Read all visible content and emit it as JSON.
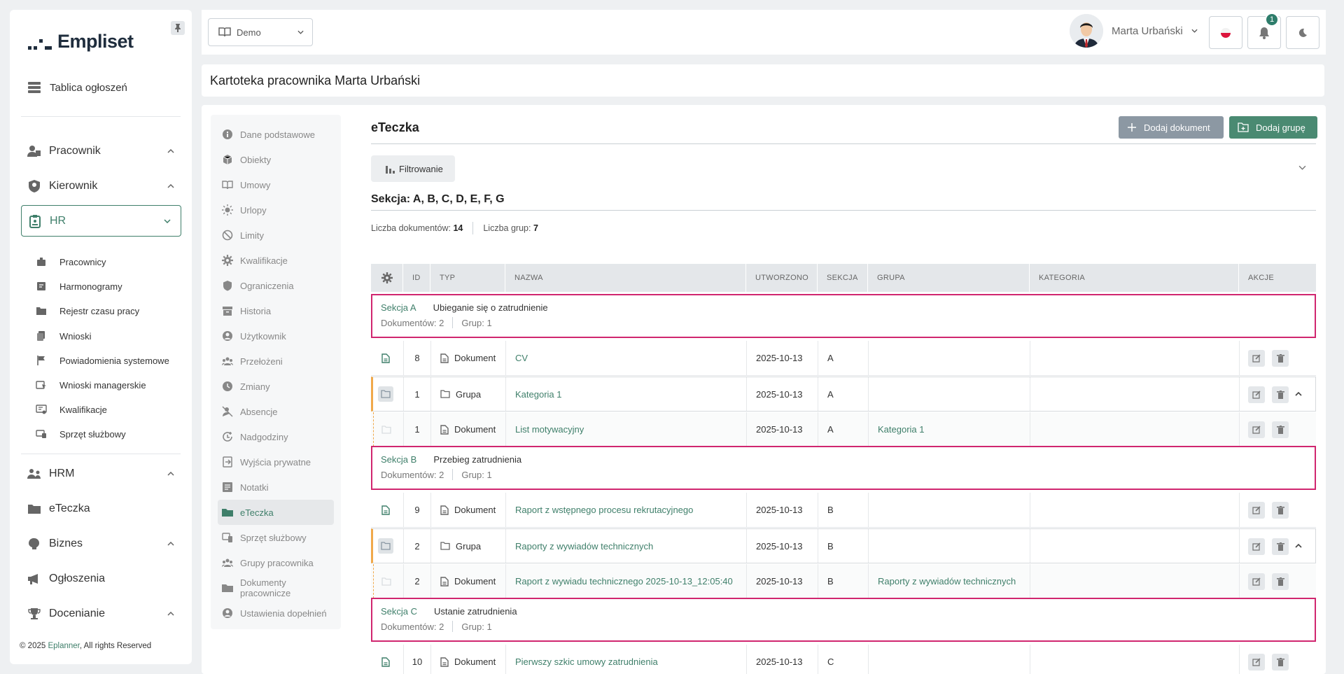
{
  "app": {
    "brand": "Empliset",
    "footer_year": "© 2025",
    "footer_link": "Eplanner",
    "footer_rest": ", All rights Reserved"
  },
  "sidebar": {
    "board": "Tablica ogłoszeń",
    "sections": [
      {
        "label": "Pracownik",
        "icon": "employee-icon"
      },
      {
        "label": "Kierownik",
        "icon": "manager-icon"
      },
      {
        "label": "HR",
        "icon": "hr-badge-icon"
      }
    ],
    "hr_items": [
      {
        "label": "Pracownicy",
        "icon": "employees-icon"
      },
      {
        "label": "Harmonogramy",
        "icon": "schedule-icon"
      },
      {
        "label": "Rejestr czasu pracy",
        "icon": "folder-icon"
      },
      {
        "label": "Wnioski",
        "icon": "requests-icon"
      },
      {
        "label": "Powiadomienia systemowe",
        "icon": "flag-icon"
      },
      {
        "label": "Wnioski managerskie",
        "icon": "manager-requests-icon"
      },
      {
        "label": "Kwalifikacje",
        "icon": "qualifications-icon"
      },
      {
        "label": "Sprzęt służbowy",
        "icon": "equipment-icon"
      }
    ],
    "lower": [
      {
        "label": "HRM",
        "icon": "hrm-icon"
      },
      {
        "label": "eTeczka",
        "icon": "folder-icon"
      },
      {
        "label": "Biznes",
        "icon": "business-icon"
      },
      {
        "label": "Ogłoszenia",
        "icon": "megaphone-icon"
      },
      {
        "label": "Docenianie",
        "icon": "trophy-icon"
      }
    ]
  },
  "topbar": {
    "select_value": "Demo",
    "user_name": "Marta Urbański",
    "notifications": "1"
  },
  "page_title": "Kartoteka pracownika Marta Urbański",
  "subnav": [
    {
      "label": "Dane podstawowe",
      "icon": "info-icon"
    },
    {
      "label": "Obiekty",
      "icon": "cube-icon"
    },
    {
      "label": "Umowy",
      "icon": "book-icon"
    },
    {
      "label": "Urlopy",
      "icon": "sun-icon"
    },
    {
      "label": "Limity",
      "icon": "block-icon"
    },
    {
      "label": "Kwalifikacje",
      "icon": "gear-icon"
    },
    {
      "label": "Ograniczenia",
      "icon": "shield-icon"
    },
    {
      "label": "Historia",
      "icon": "archive-icon"
    },
    {
      "label": "Użytkownik",
      "icon": "user-icon"
    },
    {
      "label": "Przełożeni",
      "icon": "group-icon"
    },
    {
      "label": "Zmiany",
      "icon": "clock-icon"
    },
    {
      "label": "Absencje",
      "icon": "absence-icon"
    },
    {
      "label": "Nadgodziny",
      "icon": "overtime-icon"
    },
    {
      "label": "Wyjścia prywatne",
      "icon": "exit-icon"
    },
    {
      "label": "Notatki",
      "icon": "notes-icon"
    },
    {
      "label": "eTeczka",
      "icon": "folder-icon"
    },
    {
      "label": "Sprzęt służbowy",
      "icon": "equipment-icon"
    },
    {
      "label": "Grupy pracownika",
      "icon": "group-icon"
    },
    {
      "label": "Dokumenty pracownicze",
      "icon": "folder-icon"
    },
    {
      "label": "Ustawienia dopełnień",
      "icon": "user-icon"
    }
  ],
  "main": {
    "title": "eTeczka",
    "add_document": "Dodaj dokument",
    "add_group": "Dodaj grupę",
    "filter": "Filtrowanie",
    "section_heading": "Sekcja: A, B, C, D, E, F, G",
    "doc_count_label": "Liczba dokumentów:",
    "doc_count": "14",
    "group_count_label": "Liczba grup:",
    "group_count": "7"
  },
  "table": {
    "headers": [
      "ID",
      "TYP",
      "NAZWA",
      "UTWORZONO",
      "SEKCJA",
      "GRUPA",
      "KATEGORIA",
      "AKCJE"
    ],
    "sections": [
      {
        "code": "Sekcja A",
        "name": "Ubieganie się o zatrudnienie",
        "docs": "Dokumentów: 2",
        "groups": "Grup: 1"
      },
      {
        "code": "Sekcja B",
        "name": "Przebieg zatrudnienia",
        "docs": "Dokumentów: 2",
        "groups": "Grup: 1"
      },
      {
        "code": "Sekcja C",
        "name": "Ustanie zatrudnienia",
        "docs": "Dokumentów: 2",
        "groups": "Grup: 1"
      }
    ],
    "rows": [
      {
        "id": "8",
        "type": "Dokument",
        "name": "CV",
        "created": "2025-10-13",
        "section": "A",
        "group": "",
        "category": ""
      },
      {
        "id": "1",
        "type": "Grupa",
        "name": "Kategoria 1",
        "created": "2025-10-13",
        "section": "A",
        "group": "",
        "category": ""
      },
      {
        "id": "1",
        "type": "Dokument",
        "name": "List motywacyjny",
        "created": "2025-10-13",
        "section": "A",
        "group": "Kategoria 1",
        "category": ""
      },
      {
        "id": "9",
        "type": "Dokument",
        "name": "Raport z wstępnego procesu rekrutacyjnego",
        "created": "2025-10-13",
        "section": "B",
        "group": "",
        "category": ""
      },
      {
        "id": "2",
        "type": "Grupa",
        "name": "Raporty z wywiadów technicznych",
        "created": "2025-10-13",
        "section": "B",
        "group": "",
        "category": ""
      },
      {
        "id": "2",
        "type": "Dokument",
        "name": "Raport z wywiadu technicznego 2025-10-13_12:05:40",
        "created": "2025-10-13",
        "section": "B",
        "group": "Raporty z wywiadów technicznych",
        "category": ""
      },
      {
        "id": "10",
        "type": "Dokument",
        "name": "Pierwszy szkic umowy zatrudnienia",
        "created": "2025-10-13",
        "section": "C",
        "group": "",
        "category": ""
      }
    ]
  },
  "colors": {
    "accent": "#3f7f6a",
    "section_border": "#d0266f",
    "group_marker": "#f0a94a"
  }
}
